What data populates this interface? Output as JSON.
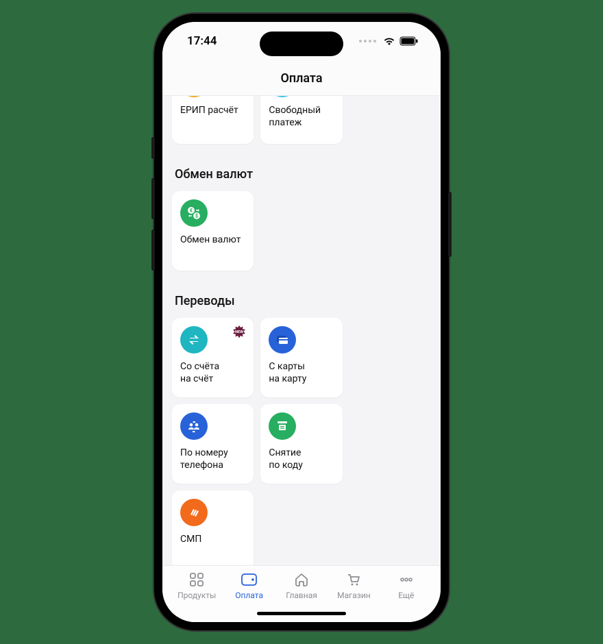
{
  "status": {
    "time": "17:44"
  },
  "header": {
    "title": "Оплата"
  },
  "sections": {
    "top": {
      "items": [
        {
          "label": "ЕРИП расчёт",
          "icon": "erip",
          "color": "#f5a623"
        },
        {
          "label": "Свободный платеж",
          "icon": "free-pay",
          "color": "#3cc3e8"
        }
      ]
    },
    "exchange": {
      "title": "Обмен валют",
      "items": [
        {
          "label": "Обмен валют",
          "icon": "exchange",
          "color": "#27ae60"
        }
      ]
    },
    "transfers": {
      "title": "Переводы",
      "items": [
        {
          "label": "Со счёта\nна счёт",
          "icon": "account-transfer",
          "color": "#1fb6c1",
          "badge": "NEW"
        },
        {
          "label": "С карты\nна карту",
          "icon": "card-transfer",
          "color": "#2862d9"
        },
        {
          "label": "По номеру\nтелефона",
          "icon": "phone-transfer",
          "color": "#2862d9"
        },
        {
          "label": "Снятие\nпо коду",
          "icon": "atm-code",
          "color": "#27ae60"
        },
        {
          "label": "СМП",
          "icon": "smp",
          "color": "#f26a1b"
        }
      ]
    }
  },
  "tabs": {
    "products": "Продукты",
    "payment": "Оплата",
    "home": "Главная",
    "shop": "Магазин",
    "more": "Ещё"
  },
  "badge": {
    "new": "NEW"
  }
}
